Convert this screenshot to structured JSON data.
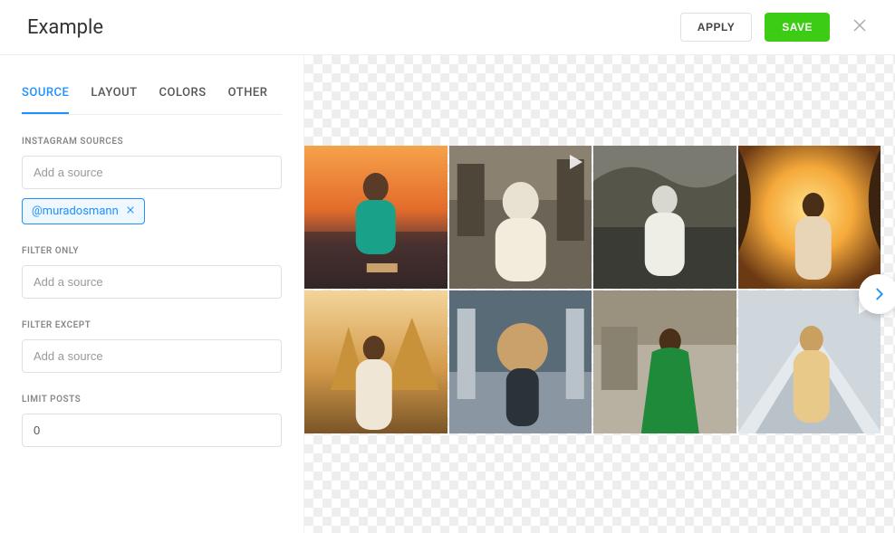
{
  "header": {
    "title": "Example",
    "apply_label": "APPLY",
    "save_label": "SAVE"
  },
  "tabs": [
    {
      "label": "SOURCE",
      "active": true
    },
    {
      "label": "LAYOUT",
      "active": false
    },
    {
      "label": "COLORS",
      "active": false
    },
    {
      "label": "OTHER",
      "active": false
    }
  ],
  "sidebar": {
    "sources_label": "INSTAGRAM SOURCES",
    "sources_placeholder": "Add a source",
    "source_chips": [
      "@muradosmann"
    ],
    "filter_only_label": "FILTER ONLY",
    "filter_only_placeholder": "Add a source",
    "filter_except_label": "FILTER EXCEPT",
    "filter_except_placeholder": "Add a source",
    "limit_label": "LIMIT POSTS",
    "limit_value": "0"
  },
  "preview": {
    "tiles": [
      {
        "is_video": false
      },
      {
        "is_video": true
      },
      {
        "is_video": false
      },
      {
        "is_video": false
      },
      {
        "is_video": false
      },
      {
        "is_video": false
      },
      {
        "is_video": false
      },
      {
        "is_video": true
      }
    ]
  }
}
